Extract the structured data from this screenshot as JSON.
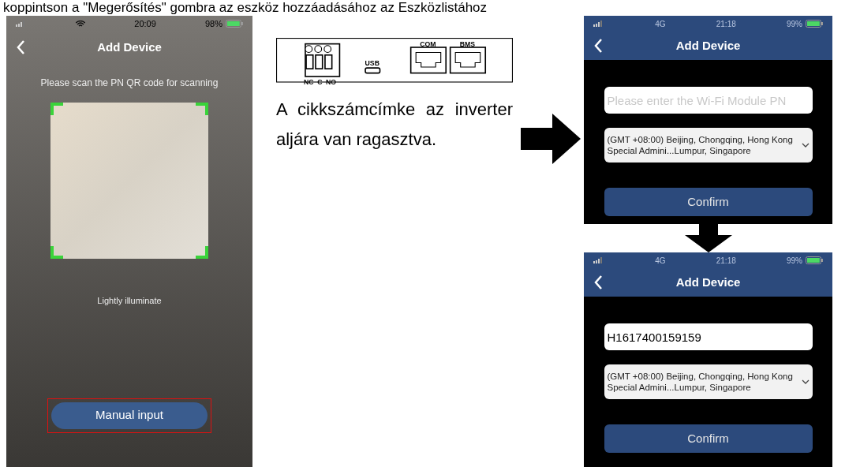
{
  "caption": "koppintson a \"Megerősítés\" gombra az eszköz hozzáadásához az Eszközlistához",
  "scan_screen": {
    "status_bar": {
      "time": "20:09",
      "battery": "98%"
    },
    "title": "Add Device",
    "instruction": "Please scan the PN QR code for scanning",
    "hint": "Lightly illuminate",
    "button": "Manual input",
    "button_highlighted": true
  },
  "device_diagram": {
    "relay_labels": [
      "NC",
      "C",
      "NO"
    ],
    "usb_label": "USB",
    "ports": [
      "COM",
      "BMS"
    ]
  },
  "note": "A cikkszámcímke az inverter aljára van ragasztva.",
  "form_screens": [
    {
      "status_bar": {
        "network": "4G",
        "time": "21:18",
        "battery": "99%"
      },
      "title": "Add Device",
      "pn_field": {
        "placeholder": "Please enter the Wi-Fi Module PN"
      },
      "timezone": "(GMT +08:00) Beijing, Chongqing, Hong Kong Special Admini...Lumpur, Singapore",
      "button": "Confirm"
    },
    {
      "status_bar": {
        "network": "4G",
        "time": "21:18",
        "battery": "99%"
      },
      "title": "Add Device",
      "pn_field": {
        "value": "H1617400159159"
      },
      "timezone": "(GMT +08:00) Beijing, Chongqing, Hong Kong Special Admini...Lumpur, Singapore",
      "button": "Confirm"
    }
  ]
}
